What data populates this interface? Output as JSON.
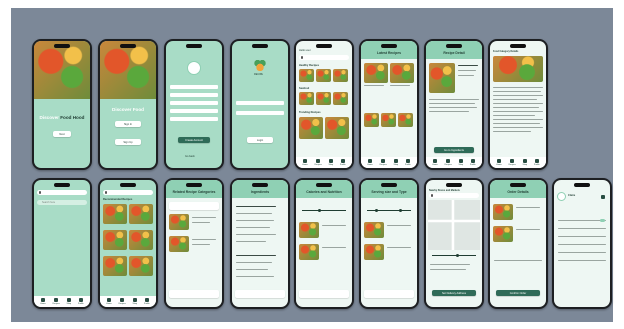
{
  "screens": {
    "s1": {
      "hero_plain": "Discover",
      "hero_accent": "Food Hood",
      "button": "Next"
    },
    "s2": {
      "hero": "Discover Food",
      "login_button": "Sign In",
      "signup_button": "Sign Up"
    },
    "s3": {
      "button": "Create Account",
      "footer_link": "Go back"
    },
    "s4": {
      "brand": "RECIPE",
      "button": "Login"
    },
    "s5": {
      "header": "Hello user",
      "section1": "Healthy Recipes",
      "section2": "Seafood",
      "section3": "Trending Recipes"
    },
    "s6": {
      "header": "Latest Recipes"
    },
    "s7": {
      "header": "Recipe Detail",
      "button": "Go to Ingredients"
    },
    "s8": {
      "header": "Food Category Details"
    },
    "s9": {
      "search_placeholder": "Search here"
    },
    "s10": {
      "header": "Recommended Recipes"
    },
    "s11": {
      "header": "Related Recipe Categories"
    },
    "s12": {
      "header": "Ingredients"
    },
    "s13": {
      "header": "Calories and Nutrition"
    },
    "s14": {
      "header": "Serving size and Type"
    },
    "s15": {
      "header": "Nearby Stores and Markets",
      "button": "Set Delivery Address"
    },
    "s16": {
      "header": "Order Details",
      "button": "Confirm Order"
    },
    "s17": {
      "header": "Profile",
      "name": "Claire"
    }
  },
  "tabbar": {
    "labels": [
      "Home",
      "Recipes",
      "Shop",
      "Profile"
    ]
  },
  "colors": {
    "background": "#7c8898",
    "screen_mint": "#a8dcc6",
    "accent_dark": "#2f6b58"
  },
  "icons": [
    "search-icon",
    "home-icon",
    "recipe-icon",
    "cart-icon",
    "user-icon",
    "back-icon",
    "bell-icon"
  ]
}
